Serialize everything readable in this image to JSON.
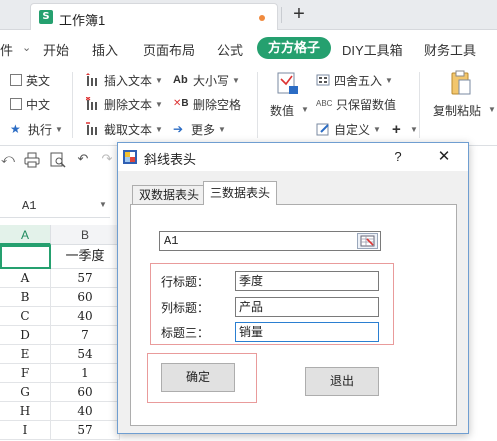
{
  "app": {
    "doc_tab_title": "工作簿1",
    "doc_icon_letter": "S",
    "new_tab_symbol": "+"
  },
  "ribbon_tabs": {
    "file_partial": "件",
    "start": "开始",
    "insert": "插入",
    "page_layout": "页面布局",
    "formula": "公式",
    "active_tab": "方方格子",
    "diy_toolbox": "DIY工具箱",
    "finance": "财务工具"
  },
  "ribbon": {
    "english_checkbox": "英文",
    "chinese_checkbox": "中文",
    "execute": "执行",
    "insert_text": "插入文本",
    "delete_text": "删除文本",
    "extract_text": "截取文本",
    "case": "大小写",
    "delete_space": "删除空格",
    "more": "更多",
    "number_value": "数值",
    "round": "四舍五入",
    "keep_number": "只保留数值",
    "custom": "自定义",
    "copy_paste": "复制粘贴"
  },
  "namebox": {
    "value": "A1"
  },
  "grid": {
    "columns": [
      "A",
      "B"
    ],
    "header_row_b": "一季度",
    "rows": [
      [
        "A",
        "57"
      ],
      [
        "B",
        "60"
      ],
      [
        "C",
        "40"
      ],
      [
        "D",
        "7"
      ],
      [
        "E",
        "54"
      ],
      [
        "F",
        "1"
      ],
      [
        "G",
        "60"
      ],
      [
        "H",
        "40"
      ],
      [
        "I",
        "57"
      ]
    ]
  },
  "dialog": {
    "title": "斜线表头",
    "help": "?",
    "close": "✕",
    "tabs": [
      "双数据表头",
      "三数据表头"
    ],
    "active_tab_index": 1,
    "cell_ref": "A1",
    "row_title_label": "行标题：",
    "row_title_value": "季度",
    "col_title_label": "列标题：",
    "col_title_value": "产品",
    "title3_label": "标题三：",
    "title3_value": "销量",
    "ok": "确定",
    "exit": "退出"
  }
}
